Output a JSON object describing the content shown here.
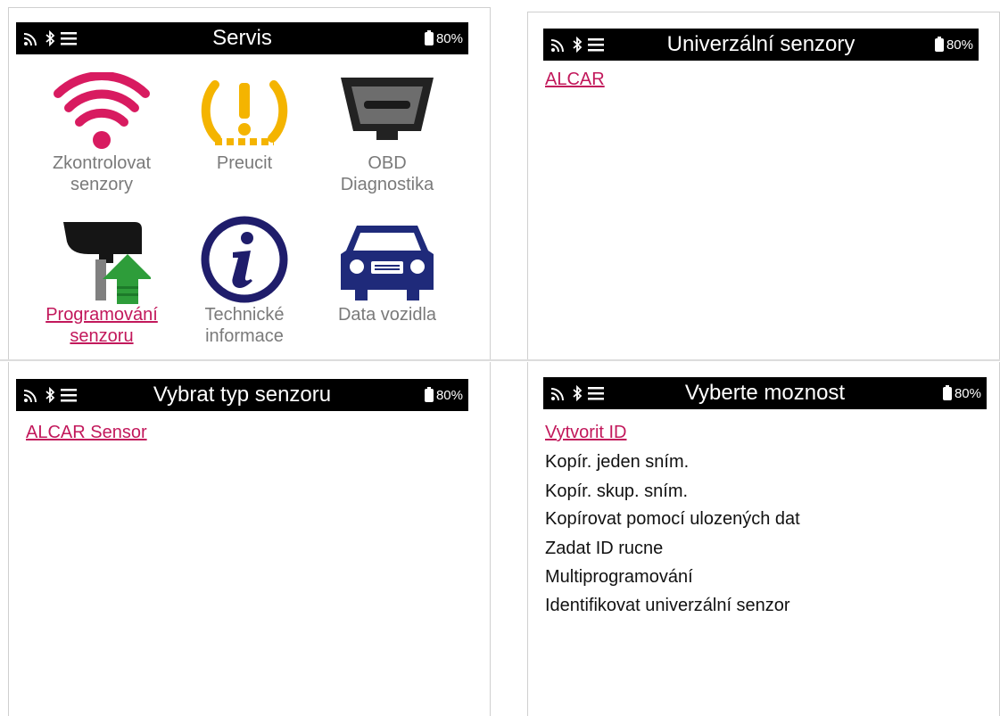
{
  "status": {
    "battery": "80%"
  },
  "screens": {
    "service": {
      "title": "Servis",
      "tiles": [
        {
          "label": "Zkontrolovat\nsenzory",
          "icon": "wifi-signal-icon",
          "color": "#d81b60"
        },
        {
          "label": "Preucit",
          "icon": "tpms-warning-icon",
          "color": "#f4b400"
        },
        {
          "label": "OBD\nDiagnostika",
          "icon": "obd-connector-icon",
          "color": "#222222"
        },
        {
          "label": "Programování\nsenzoru",
          "icon": "sensor-program-icon",
          "selected": true,
          "color": "#2e9d3a"
        },
        {
          "label": "Technické\ninformace",
          "icon": "info-icon",
          "color": "#1f1d6b"
        },
        {
          "label": "Data vozidla",
          "icon": "car-icon",
          "color": "#1f2a7a"
        }
      ]
    },
    "universal_sensors": {
      "title": "Univerzální senzory",
      "items": [
        "ALCAR"
      ]
    },
    "sensor_type": {
      "title": "Vybrat typ senzoru",
      "items": [
        "ALCAR Sensor"
      ]
    },
    "options": {
      "title": "Vyberte moznost",
      "items": [
        "Vytvorit ID",
        "Kopír. jeden sním.",
        "Kopír. skup. sním.",
        "Kopírovat pomocí ulozených dat",
        "Zadat ID rucne",
        "Multiprogramování",
        "Identifikovat univerzální senzor"
      ]
    }
  },
  "colors": {
    "accent": "#c2185b",
    "bar": "#000000"
  }
}
